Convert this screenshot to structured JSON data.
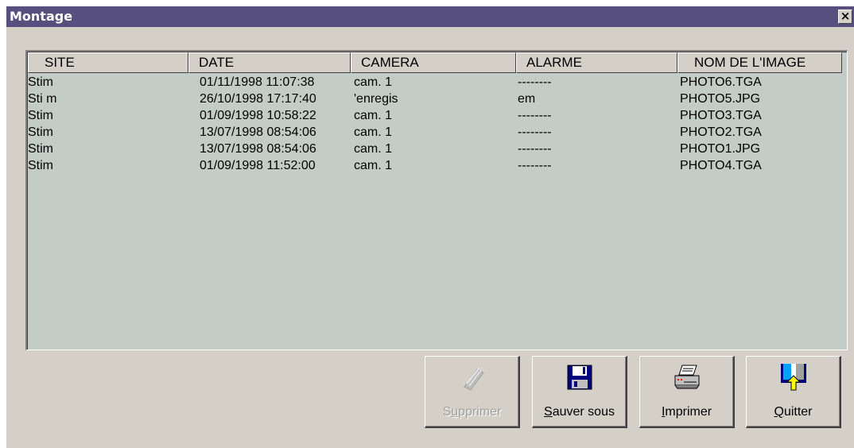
{
  "window": {
    "title": "Montage",
    "close_label": "×"
  },
  "list": {
    "columns": [
      "SITE",
      "DATE",
      "CAMERA",
      "ALARME",
      "NOM DE L'IMAGE"
    ],
    "rows": [
      [
        "Stim",
        "01/11/1998 11:07:38",
        "cam. 1",
        "--------",
        "PHOTO6.TGA"
      ],
      [
        "Sti m",
        "26/10/1998 17:17:40",
        "'enregis",
        "em",
        "PHOTO5.JPG"
      ],
      [
        "Stim",
        "01/09/1998 10:58:22",
        "cam. 1",
        "--------",
        "PHOTO3.TGA"
      ],
      [
        "Stim",
        "13/07/1998 08:54:06",
        "cam. 1",
        "--------",
        "PHOTO2.TGA"
      ],
      [
        "Stim",
        "13/07/1998 08:54:06",
        "cam. 1",
        "--------",
        "PHOTO1.JPG"
      ],
      [
        "Stim",
        "01/09/1998 11:52:00",
        "cam. 1",
        "--------",
        "PHOTO4.TGA"
      ]
    ]
  },
  "buttons": {
    "delete": {
      "pre": "S",
      "mnemonic": "u",
      "post": "pprimer",
      "icon": "eraser-icon",
      "enabled": false
    },
    "save_as": {
      "pre": "",
      "mnemonic": "S",
      "post": "auver sous",
      "icon": "floppy-disk-icon",
      "enabled": true
    },
    "print": {
      "pre": "",
      "mnemonic": "I",
      "post": "mprimer",
      "icon": "printer-icon",
      "enabled": true
    },
    "quit": {
      "pre": "",
      "mnemonic": "Q",
      "post": "uitter",
      "icon": "exit-door-icon",
      "enabled": true
    }
  }
}
